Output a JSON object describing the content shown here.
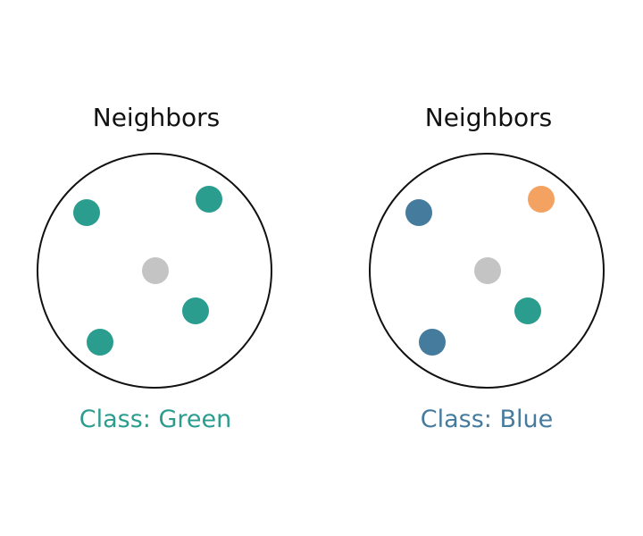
{
  "colors": {
    "green": "#2a9d8f",
    "blue": "#457b9d",
    "orange": "#f4a261",
    "query": "#c4c4c4",
    "circle_stroke": "#111111"
  },
  "panels": [
    {
      "title": "Neighbors",
      "class_label": "Class: Green",
      "label_color_key": "green",
      "points": [
        {
          "class": "green"
        },
        {
          "class": "green"
        },
        {
          "class": "green"
        },
        {
          "class": "green"
        }
      ],
      "query": {
        "class": "query"
      }
    },
    {
      "title": "Neighbors",
      "class_label": "Class: Blue",
      "label_color_key": "blue",
      "points": [
        {
          "class": "blue"
        },
        {
          "class": "orange"
        },
        {
          "class": "green"
        },
        {
          "class": "blue"
        }
      ],
      "query": {
        "class": "query"
      }
    }
  ]
}
